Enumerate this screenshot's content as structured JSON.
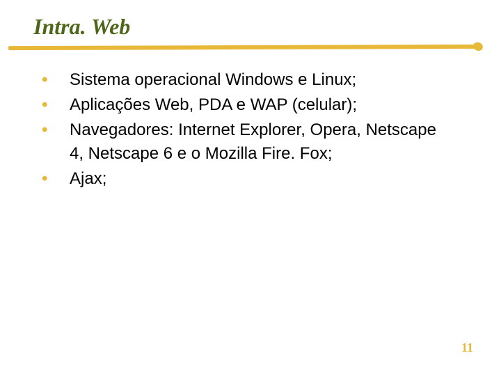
{
  "title": "Intra. Web",
  "bullets": [
    {
      "marker": "•",
      "text": "Sistema operacional Windows e Linux;"
    },
    {
      "marker": "•",
      "text": "Aplicações Web, PDA e WAP (celular);"
    },
    {
      "marker": "•",
      "text": "Navegadores: Internet Explorer, Opera, Netscape 4, Netscape 6 e o Mozilla Fire. Fox;"
    },
    {
      "marker": "•",
      "text": "Ajax;"
    }
  ],
  "page_number": "11"
}
